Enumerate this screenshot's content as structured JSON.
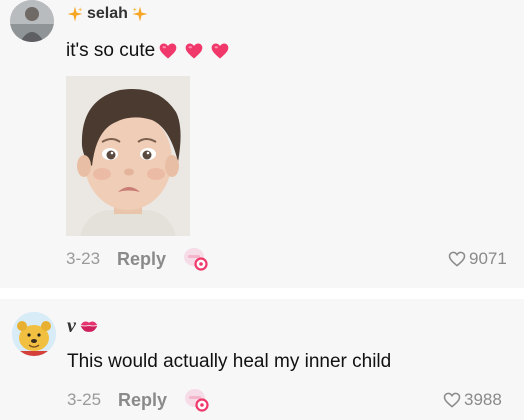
{
  "comments": [
    {
      "username": "selah",
      "text": "it's so cute",
      "date": "3-23",
      "reply_label": "Reply",
      "like_count": "9071"
    },
    {
      "username": "v",
      "text": "This would actually heal my inner child",
      "date": "3-25",
      "reply_label": "Reply",
      "like_count": "3988"
    }
  ],
  "colors": {
    "card_background": "#f7f7f8",
    "muted_text": "#8a8a8a",
    "heart_pink": "#f0386b",
    "sparkle_orange": "#f5a623"
  },
  "icons": {
    "sparkle": "sparkle-icon",
    "heart_emoji": "heart-emoji-icon",
    "kiss": "kiss-lips-icon",
    "like": "heart-outline-icon",
    "react": "sticker-react-icon"
  }
}
